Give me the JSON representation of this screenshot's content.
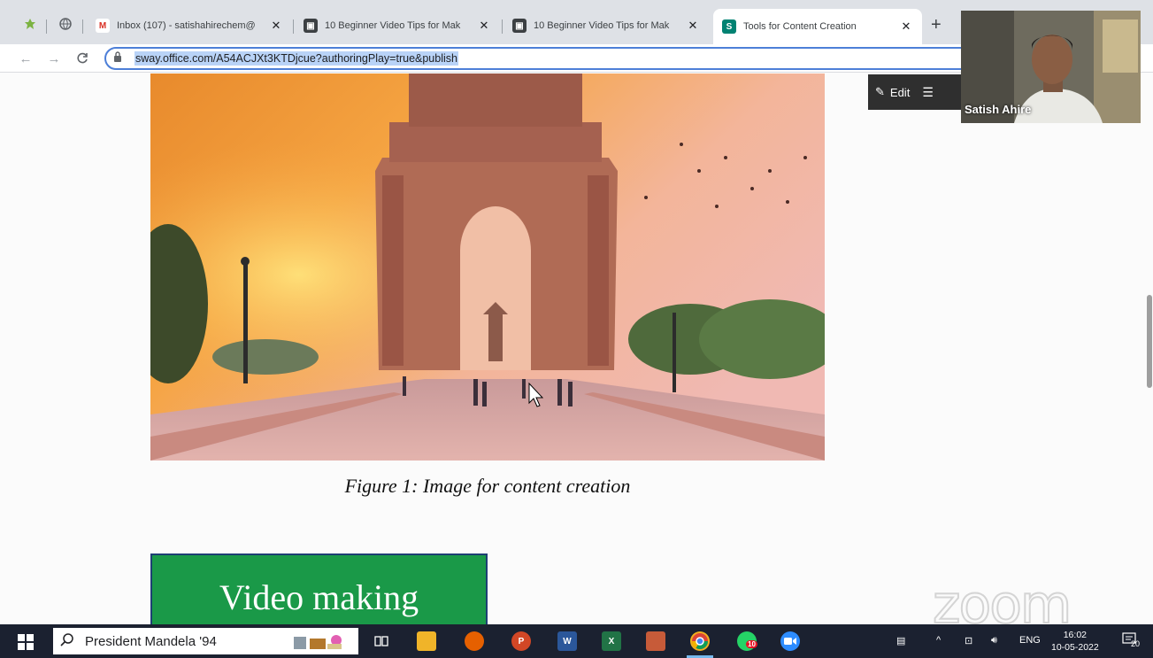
{
  "browser": {
    "tabs": [
      {
        "title": "Inbox (107) - satishahirechem@",
        "favicon": "gmail-icon",
        "active": false
      },
      {
        "title": "10 Beginner Video Tips for Mak",
        "favicon": "video-tips-icon",
        "active": false
      },
      {
        "title": "10 Beginner Video Tips for Mak",
        "favicon": "video-tips-icon",
        "active": false
      },
      {
        "title": "Tools for Content Creation",
        "favicon": "sway-icon",
        "active": true
      }
    ],
    "url": "sway.office.com/A54ACJXt3KTDjcue?authoringPlay=true&publish"
  },
  "sway": {
    "edit_label": "Edit",
    "caption": "Figure 1: Image for content creation",
    "section_heading": "Video making"
  },
  "video": {
    "participant_name": "Satish Ahire"
  },
  "watermark": "zoom",
  "taskbar": {
    "search_text": "President Mandela '94",
    "language": "ENG",
    "time": "16:02",
    "date": "10-05-2022",
    "notification_count": "20",
    "whatsapp_badge": "10"
  },
  "colors": {
    "accent_green": "#1a9948",
    "taskbar_bg": "#1b2130",
    "omnibox_border": "#4d7fd8"
  }
}
